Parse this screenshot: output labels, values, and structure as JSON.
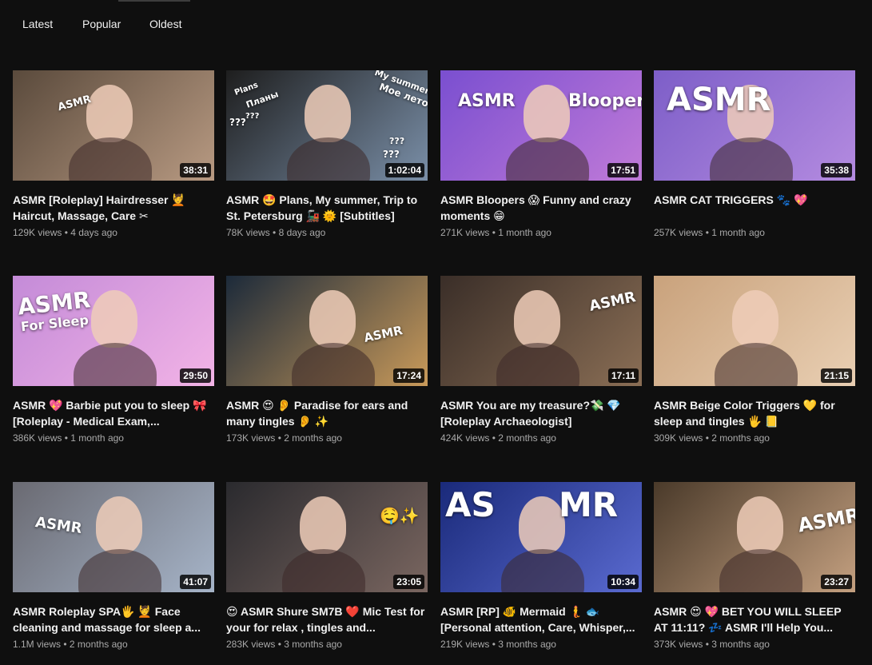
{
  "tabs": [
    {
      "label": "Latest"
    },
    {
      "label": "Popular"
    },
    {
      "label": "Oldest"
    }
  ],
  "videos": [
    {
      "title": "ASMR [Roleplay] Hairdresser 💆 Haircut, Massage, Care ✂",
      "views": "129K views",
      "age": "4 days ago",
      "duration": "38:31",
      "thumb_text": [
        "ASMR"
      ],
      "colors": [
        "#5a4a3c",
        "#b89a82"
      ]
    },
    {
      "title": "ASMR 🤩 Plans, My summer, Trip to St. Petersburg 🚂 🌞 [Subtitles]",
      "views": "78K views",
      "age": "8 days ago",
      "duration": "1:02:04",
      "thumb_text": [
        "Plans",
        "Планы",
        "My summer",
        "Мое лето",
        "???",
        "???",
        "???",
        "???"
      ],
      "colors": [
        "#1e1e1e",
        "#7a8fa8"
      ]
    },
    {
      "title": "ASMR Bloopers 😱 Funny and crazy moments 😁",
      "views": "271K views",
      "age": "1 month ago",
      "duration": "17:51",
      "thumb_text": [
        "ASMR",
        "Bloopers"
      ],
      "colors": [
        "#7a4fd0",
        "#c07ad8"
      ]
    },
    {
      "title": "ASMR CAT TRIGGERS 🐾 💖",
      "views": "257K views",
      "age": "1 month ago",
      "duration": "35:38",
      "thumb_text": [
        "ASMR"
      ],
      "colors": [
        "#7d5ec8",
        "#b48be0"
      ]
    },
    {
      "title": "ASMR 💖 Barbie put you to sleep 🎀 [Roleplay - Medical Exam,...",
      "views": "386K views",
      "age": "1 month ago",
      "duration": "29:50",
      "thumb_text": [
        "ASMR",
        "For Sleep"
      ],
      "colors": [
        "#c48bd8",
        "#f2b3e6"
      ]
    },
    {
      "title": "ASMR 😍 👂 Paradise for ears and many tingles 👂 ✨",
      "views": "173K views",
      "age": "2 months ago",
      "duration": "17:24",
      "thumb_text": [
        "ASMR"
      ],
      "colors": [
        "#1c2a3a",
        "#c99a5a"
      ]
    },
    {
      "title": "ASMR You are my treasure?💸 💎 [Roleplay Archaeologist]",
      "views": "424K views",
      "age": "2 months ago",
      "duration": "17:11",
      "thumb_text": [
        "ASMR"
      ],
      "colors": [
        "#3a2e28",
        "#8a6e55"
      ]
    },
    {
      "title": "ASMR Beige Color Triggers 💛 for sleep and tingles 🖐 📒",
      "views": "309K views",
      "age": "2 months ago",
      "duration": "21:15",
      "thumb_text": [],
      "colors": [
        "#c9a27c",
        "#e9cfb3"
      ]
    },
    {
      "title": "ASMR Roleplay SPA🖐 💆 Face cleaning and massage for sleep a...",
      "views": "1.1M views",
      "age": "2 months ago",
      "duration": "41:07",
      "thumb_text": [
        "ASMR"
      ],
      "colors": [
        "#6a6a72",
        "#a6b4c8"
      ]
    },
    {
      "title": "😍 ASMR Shure SM7B ❤️ Mic Test for your for relax , tingles and...",
      "views": "283K views",
      "age": "3 months ago",
      "duration": "23:05",
      "thumb_text": [
        "🤤✨"
      ],
      "colors": [
        "#2a2a2e",
        "#7a6660"
      ]
    },
    {
      "title": "ASMR [RP] 🐠 Mermaid 🧜 🐟 [Personal attention, Care, Whisper,...",
      "views": "219K views",
      "age": "3 months ago",
      "duration": "10:34",
      "thumb_text": [
        "AS",
        "MR"
      ],
      "colors": [
        "#1a2a7a",
        "#5a6ad0"
      ]
    },
    {
      "title": "ASMR 😍 💖 BET YOU WILL SLEEP AT 11:11? 💤 ASMR I'll Help You...",
      "views": "373K views",
      "age": "3 months ago",
      "duration": "23:27",
      "thumb_text": [
        "ASMR"
      ],
      "colors": [
        "#4a3a2a",
        "#c4a080"
      ]
    }
  ]
}
